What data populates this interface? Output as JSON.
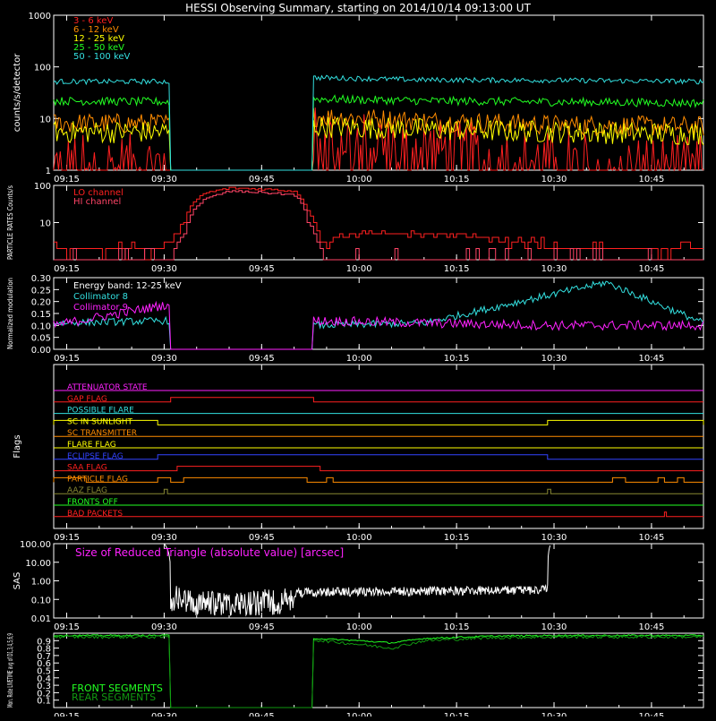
{
  "title": "HESSI Observing Summary, starting on 2014/10/14 09:13:00 UT",
  "colors": {
    "background": "#000000",
    "axes": "#ffffff",
    "c3_6": "#ff2020",
    "c6_12": "#ff8c00",
    "c12_25": "#ffff00",
    "c25_50": "#22ff22",
    "c50_100": "#33e0e0",
    "magenta": "#ff22ff",
    "hi_channel": "#ff4466",
    "front_seg": "#22ff22",
    "rear_seg": "#119911"
  },
  "time_axis": {
    "start": "09:13",
    "end": "10:53",
    "ticks": [
      "09:15",
      "09:30",
      "09:45",
      "10:00",
      "10:15",
      "10:30",
      "10:45"
    ]
  },
  "chart_data": [
    {
      "id": "xray",
      "type": "line",
      "title": "HESSI Observing Summary, starting on 2014/10/14 09:13:00 UT",
      "ylabel": "counts/s/detector",
      "yscale": "log",
      "ylim": [
        1,
        1000
      ],
      "yticks": [
        "1",
        "10",
        "100",
        "1000"
      ],
      "legend": "top-left",
      "gaps": [
        [
          "09:31",
          "09:53"
        ]
      ],
      "series": [
        {
          "name": "3 - 6 keV",
          "color": "#ff2020",
          "x": [
            "09:13",
            "09:31",
            "09:53",
            "10:05",
            "10:20",
            "10:30",
            "10:53"
          ],
          "values": [
            1.3,
            1.3,
            4.5,
            3.2,
            2.0,
            1.4,
            1.2
          ]
        },
        {
          "name": "6 - 12 keV",
          "color": "#ff8c00",
          "x": [
            "09:13",
            "09:31",
            "09:53",
            "10:10",
            "10:30",
            "10:53"
          ],
          "values": [
            8,
            8,
            11,
            9,
            7.5,
            7
          ]
        },
        {
          "name": "12 - 25 keV",
          "color": "#ffff00",
          "x": [
            "09:13",
            "09:31",
            "09:53",
            "10:10",
            "10:30",
            "10:53"
          ],
          "values": [
            5.5,
            5.5,
            7,
            6.2,
            5.5,
            5
          ]
        },
        {
          "name": "25 - 50 keV",
          "color": "#22ff22",
          "x": [
            "09:13",
            "09:31",
            "09:53",
            "10:10",
            "10:30",
            "10:53"
          ],
          "values": [
            22,
            21,
            24,
            22,
            21,
            20
          ]
        },
        {
          "name": "50 - 100 keV",
          "color": "#33e0e0",
          "x": [
            "09:13",
            "09:31",
            "09:53",
            "10:10",
            "10:30",
            "10:53"
          ],
          "values": [
            52,
            52,
            62,
            56,
            55,
            52
          ]
        }
      ]
    },
    {
      "id": "particle",
      "type": "line",
      "ylabel": "PARTICLE RATES Counts/s",
      "yscale": "log",
      "ylim": [
        1,
        100
      ],
      "yticks": [
        "10",
        "100"
      ],
      "legend": "top-left",
      "series": [
        {
          "name": "LO channel",
          "color": "#ff2020",
          "x": [
            "09:13",
            "09:27",
            "09:31",
            "09:33",
            "09:36",
            "09:40",
            "09:45",
            "09:50",
            "09:52",
            "09:54",
            "09:56",
            "10:00",
            "10:10",
            "10:20",
            "10:30",
            "10:40",
            "10:53"
          ],
          "values": [
            2,
            2,
            3,
            10,
            60,
            85,
            80,
            70,
            20,
            2,
            4,
            5,
            5,
            4,
            2,
            2,
            2
          ]
        },
        {
          "name": "HI channel",
          "color": "#ff4466",
          "x": [
            "09:13",
            "09:31",
            "09:33",
            "09:36",
            "09:40",
            "09:45",
            "09:50",
            "09:52",
            "09:54",
            "10:53"
          ],
          "values": [
            1,
            1,
            5,
            40,
            70,
            65,
            55,
            10,
            1,
            1
          ]
        }
      ]
    },
    {
      "id": "modulation",
      "type": "line",
      "ylabel": "Normalized modulation",
      "ylim": [
        0,
        0.3
      ],
      "yticks": [
        "0.00",
        "0.05",
        "0.10",
        "0.15",
        "0.20",
        "0.25",
        "0.30"
      ],
      "legend": "top-left",
      "legend_title": "Energy band: 12-25 keV",
      "gaps": [
        [
          "09:31",
          "09:53"
        ]
      ],
      "series": [
        {
          "name": "Collimator 8",
          "color": "#33e0e0",
          "x": [
            "09:13",
            "09:31",
            "09:53",
            "10:10",
            "10:38",
            "10:53"
          ],
          "values": [
            0.11,
            0.12,
            0.1,
            0.11,
            0.28,
            0.11
          ]
        },
        {
          "name": "Collimator 9",
          "color": "#ff22ff",
          "x": [
            "09:13",
            "09:31",
            "09:53",
            "10:10",
            "10:30",
            "10:53"
          ],
          "values": [
            0.1,
            0.19,
            0.12,
            0.11,
            0.1,
            0.1
          ]
        }
      ]
    },
    {
      "id": "flags",
      "type": "line",
      "ylabel": "Flags",
      "series": [
        {
          "name": "ATTENUATOR STATE",
          "color": "#ff22ff",
          "intervals": []
        },
        {
          "name": "GAP FLAG",
          "color": "#ff2020",
          "intervals": [
            [
              "09:31",
              "09:53"
            ]
          ]
        },
        {
          "name": "POSSIBLE FLARE",
          "color": "#33e0e0",
          "intervals": []
        },
        {
          "name": "SC IN SUNLIGHT",
          "color": "#ffff00",
          "intervals": [
            [
              "09:13",
              "09:29"
            ],
            [
              "10:29",
              "10:53"
            ]
          ]
        },
        {
          "name": "SC TRANSMITTER",
          "color": "#ff8c00",
          "intervals": []
        },
        {
          "name": "FLARE FLAG",
          "color": "#ffff00",
          "intervals": []
        },
        {
          "name": "ECLIPSE FLAG",
          "color": "#3344ff",
          "intervals": [
            [
              "09:29",
              "10:29"
            ]
          ]
        },
        {
          "name": "SAA FLAG",
          "color": "#ff2020",
          "intervals": [
            [
              "09:32",
              "09:54"
            ]
          ]
        },
        {
          "name": "PARTICLE FLAG",
          "color": "#ff8c00",
          "intervals": [
            [
              "09:13",
              "09:18"
            ],
            [
              "09:29",
              "09:31"
            ],
            [
              "09:33",
              "09:52"
            ],
            [
              "09:55",
              "09:56"
            ],
            [
              "10:39",
              "10:41"
            ],
            [
              "10:46",
              "10:47"
            ],
            [
              "10:49",
              "10:50"
            ]
          ]
        },
        {
          "name": "AAZ FLAG",
          "color": "#888833",
          "intervals": [
            [
              "09:30",
              "09:30.5"
            ],
            [
              "10:29",
              "10:29.5"
            ]
          ]
        },
        {
          "name": "FRONTS OFF",
          "color": "#22ff22",
          "intervals": []
        },
        {
          "name": "BAD PACKETS",
          "color": "#ff2020",
          "intervals": [
            [
              "10:47",
              "10:47.3"
            ]
          ]
        }
      ]
    },
    {
      "id": "sas",
      "type": "line",
      "title": "Size of Reduced Triangle (absolute value) [arcsec]",
      "ylabel": "SAS",
      "yscale": "log",
      "ylim": [
        0.01,
        100
      ],
      "yticks": [
        "0.01",
        "0.10",
        "1.00",
        "10.00",
        "100.00"
      ],
      "series": [
        {
          "color": "#ffffff",
          "x": [
            "09:30",
            "09:31",
            "09:35",
            "09:45",
            "09:55",
            "10:10",
            "10:25",
            "10:29",
            "10:29.5"
          ],
          "values": [
            100,
            0.6,
            0.3,
            0.35,
            0.45,
            0.5,
            0.55,
            0.6,
            100
          ]
        }
      ]
    },
    {
      "id": "livetime",
      "type": "line",
      "ylabel": "Mon. Rate LIVETIME avg of D1,3,4,5,6,9",
      "ylim": [
        0,
        1
      ],
      "yticks": [
        "0.1",
        "0.2",
        "0.3",
        "0.4",
        "0.5",
        "0.6",
        "0.7",
        "0.8",
        "0.9"
      ],
      "legend": "bottom-left",
      "gaps": [
        [
          "09:31",
          "09:53"
        ]
      ],
      "series": [
        {
          "name": "FRONT SEGMENTS",
          "color": "#22ff22",
          "x": [
            "09:13",
            "09:31",
            "09:53",
            "10:00",
            "10:05",
            "10:10",
            "10:20",
            "10:30",
            "10:53"
          ],
          "values": [
            0.97,
            0.97,
            0.93,
            0.9,
            0.87,
            0.93,
            0.96,
            0.97,
            0.97
          ]
        },
        {
          "name": "REAR SEGMENTS",
          "color": "#119911",
          "x": [
            "09:13",
            "09:31",
            "09:53",
            "10:00",
            "10:05",
            "10:10",
            "10:20",
            "10:30",
            "10:53"
          ],
          "values": [
            0.95,
            0.95,
            0.91,
            0.85,
            0.8,
            0.9,
            0.94,
            0.95,
            0.95
          ]
        }
      ]
    }
  ]
}
